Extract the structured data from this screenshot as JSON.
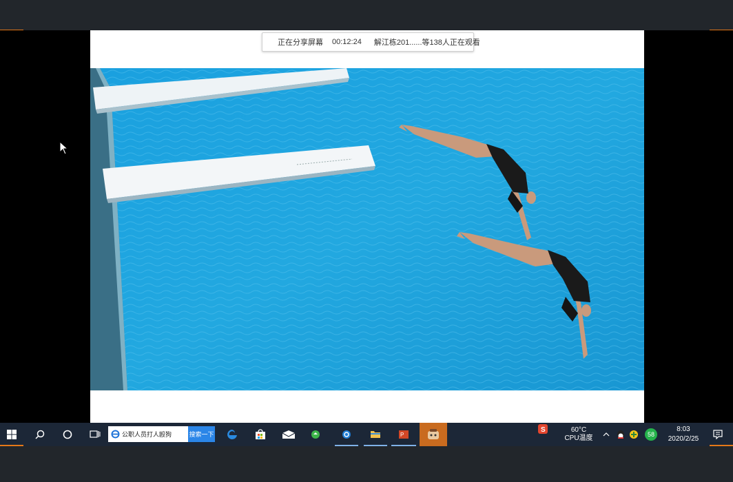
{
  "share_bar": {
    "status": "正在分享屏幕",
    "elapsed": "00:12:24",
    "viewers": "解江栋201......等138人正在观看"
  },
  "taskbar": {
    "search_placeholder": "公职人员打人殴狗",
    "search_button": "搜索一下",
    "tray": {
      "temperature": "60°C",
      "temperature_label": "CPU温度",
      "badge_count": "58",
      "time": "8:03",
      "date": "2020/2/25"
    }
  },
  "colors": {
    "accent_orange": "#e57818",
    "taskbar_bg": "#1c2737",
    "pool_blue": "#1ea3dc"
  }
}
